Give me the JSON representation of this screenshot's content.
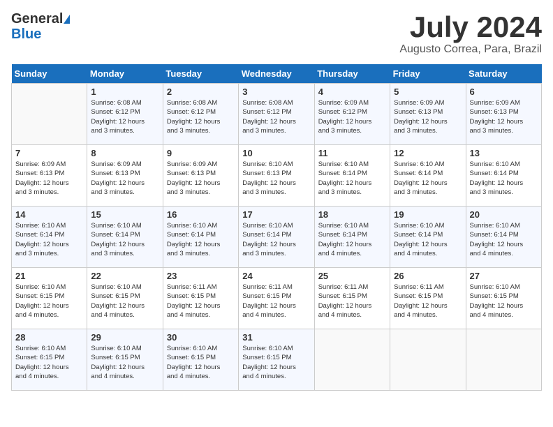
{
  "header": {
    "logo_line1": "General",
    "logo_line2": "Blue",
    "month": "July 2024",
    "location": "Augusto Correa, Para, Brazil"
  },
  "weekdays": [
    "Sunday",
    "Monday",
    "Tuesday",
    "Wednesday",
    "Thursday",
    "Friday",
    "Saturday"
  ],
  "weeks": [
    [
      {
        "day": "",
        "info": ""
      },
      {
        "day": "1",
        "info": "Sunrise: 6:08 AM\nSunset: 6:12 PM\nDaylight: 12 hours\nand 3 minutes."
      },
      {
        "day": "2",
        "info": "Sunrise: 6:08 AM\nSunset: 6:12 PM\nDaylight: 12 hours\nand 3 minutes."
      },
      {
        "day": "3",
        "info": "Sunrise: 6:08 AM\nSunset: 6:12 PM\nDaylight: 12 hours\nand 3 minutes."
      },
      {
        "day": "4",
        "info": "Sunrise: 6:09 AM\nSunset: 6:12 PM\nDaylight: 12 hours\nand 3 minutes."
      },
      {
        "day": "5",
        "info": "Sunrise: 6:09 AM\nSunset: 6:13 PM\nDaylight: 12 hours\nand 3 minutes."
      },
      {
        "day": "6",
        "info": "Sunrise: 6:09 AM\nSunset: 6:13 PM\nDaylight: 12 hours\nand 3 minutes."
      }
    ],
    [
      {
        "day": "7",
        "info": "Sunrise: 6:09 AM\nSunset: 6:13 PM\nDaylight: 12 hours\nand 3 minutes."
      },
      {
        "day": "8",
        "info": "Sunrise: 6:09 AM\nSunset: 6:13 PM\nDaylight: 12 hours\nand 3 minutes."
      },
      {
        "day": "9",
        "info": "Sunrise: 6:09 AM\nSunset: 6:13 PM\nDaylight: 12 hours\nand 3 minutes."
      },
      {
        "day": "10",
        "info": "Sunrise: 6:10 AM\nSunset: 6:13 PM\nDaylight: 12 hours\nand 3 minutes."
      },
      {
        "day": "11",
        "info": "Sunrise: 6:10 AM\nSunset: 6:14 PM\nDaylight: 12 hours\nand 3 minutes."
      },
      {
        "day": "12",
        "info": "Sunrise: 6:10 AM\nSunset: 6:14 PM\nDaylight: 12 hours\nand 3 minutes."
      },
      {
        "day": "13",
        "info": "Sunrise: 6:10 AM\nSunset: 6:14 PM\nDaylight: 12 hours\nand 3 minutes."
      }
    ],
    [
      {
        "day": "14",
        "info": "Sunrise: 6:10 AM\nSunset: 6:14 PM\nDaylight: 12 hours\nand 3 minutes."
      },
      {
        "day": "15",
        "info": "Sunrise: 6:10 AM\nSunset: 6:14 PM\nDaylight: 12 hours\nand 3 minutes."
      },
      {
        "day": "16",
        "info": "Sunrise: 6:10 AM\nSunset: 6:14 PM\nDaylight: 12 hours\nand 3 minutes."
      },
      {
        "day": "17",
        "info": "Sunrise: 6:10 AM\nSunset: 6:14 PM\nDaylight: 12 hours\nand 3 minutes."
      },
      {
        "day": "18",
        "info": "Sunrise: 6:10 AM\nSunset: 6:14 PM\nDaylight: 12 hours\nand 4 minutes."
      },
      {
        "day": "19",
        "info": "Sunrise: 6:10 AM\nSunset: 6:14 PM\nDaylight: 12 hours\nand 4 minutes."
      },
      {
        "day": "20",
        "info": "Sunrise: 6:10 AM\nSunset: 6:14 PM\nDaylight: 12 hours\nand 4 minutes."
      }
    ],
    [
      {
        "day": "21",
        "info": "Sunrise: 6:10 AM\nSunset: 6:15 PM\nDaylight: 12 hours\nand 4 minutes."
      },
      {
        "day": "22",
        "info": "Sunrise: 6:10 AM\nSunset: 6:15 PM\nDaylight: 12 hours\nand 4 minutes."
      },
      {
        "day": "23",
        "info": "Sunrise: 6:11 AM\nSunset: 6:15 PM\nDaylight: 12 hours\nand 4 minutes."
      },
      {
        "day": "24",
        "info": "Sunrise: 6:11 AM\nSunset: 6:15 PM\nDaylight: 12 hours\nand 4 minutes."
      },
      {
        "day": "25",
        "info": "Sunrise: 6:11 AM\nSunset: 6:15 PM\nDaylight: 12 hours\nand 4 minutes."
      },
      {
        "day": "26",
        "info": "Sunrise: 6:11 AM\nSunset: 6:15 PM\nDaylight: 12 hours\nand 4 minutes."
      },
      {
        "day": "27",
        "info": "Sunrise: 6:10 AM\nSunset: 6:15 PM\nDaylight: 12 hours\nand 4 minutes."
      }
    ],
    [
      {
        "day": "28",
        "info": "Sunrise: 6:10 AM\nSunset: 6:15 PM\nDaylight: 12 hours\nand 4 minutes."
      },
      {
        "day": "29",
        "info": "Sunrise: 6:10 AM\nSunset: 6:15 PM\nDaylight: 12 hours\nand 4 minutes."
      },
      {
        "day": "30",
        "info": "Sunrise: 6:10 AM\nSunset: 6:15 PM\nDaylight: 12 hours\nand 4 minutes."
      },
      {
        "day": "31",
        "info": "Sunrise: 6:10 AM\nSunset: 6:15 PM\nDaylight: 12 hours\nand 4 minutes."
      },
      {
        "day": "",
        "info": ""
      },
      {
        "day": "",
        "info": ""
      },
      {
        "day": "",
        "info": ""
      }
    ]
  ]
}
